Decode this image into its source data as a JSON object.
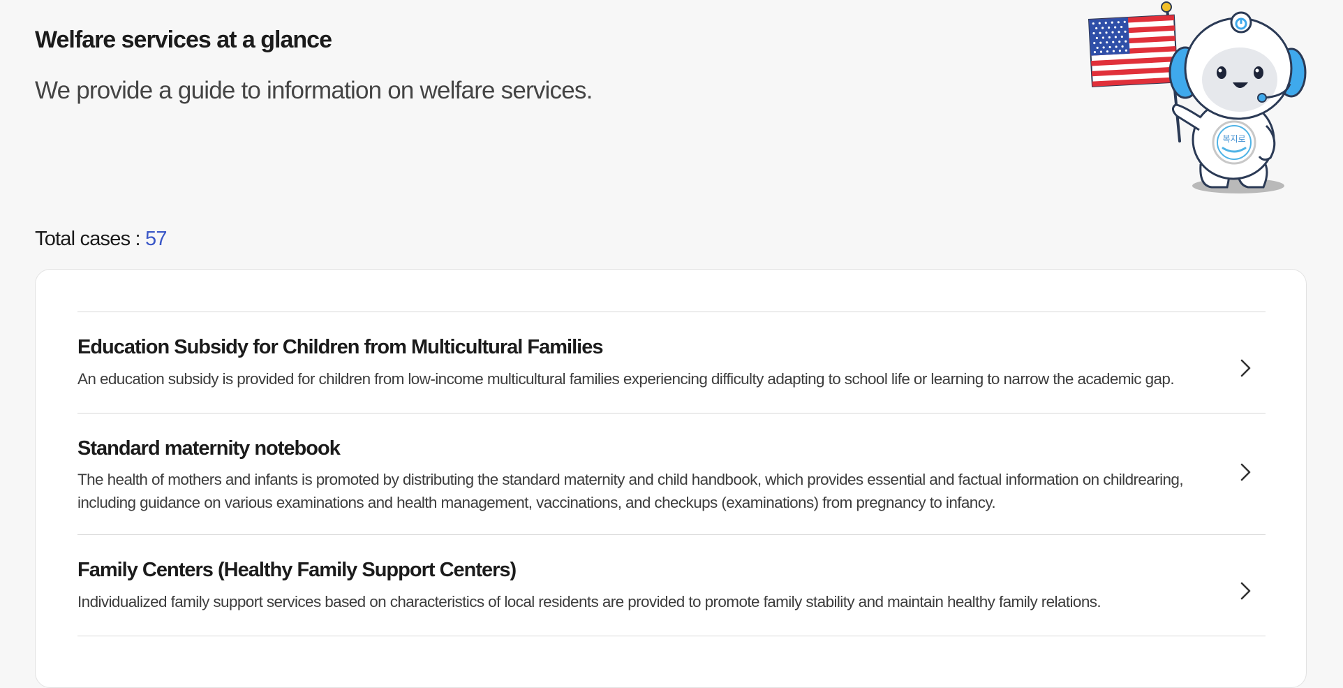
{
  "header": {
    "title": "Welfare services at a glance",
    "subtitle": "We provide a guide to information on welfare services."
  },
  "mascot": {
    "icon": "mascot-with-us-flag-icon",
    "badge_text": "복지로"
  },
  "summary": {
    "label": "Total cases : ",
    "count": "57"
  },
  "services": [
    {
      "title": "Education Subsidy for Children from Multicultural Families",
      "description": "An education subsidy is provided for children from low-income multicultural families experiencing difficulty adapting to school life or learning to narrow the academic gap.",
      "icon": "chevron-right-icon"
    },
    {
      "title": "Standard maternity notebook",
      "description": "The health of mothers and infants is promoted by distributing the standard maternity and child handbook, which provides essential and factual information on childrearing, including guidance on various examinations and health management, vaccinations, and checkups (examinations) from pregnancy to infancy.",
      "icon": "chevron-right-icon"
    },
    {
      "title": "Family Centers (Healthy Family Support Centers)",
      "description": "Individualized family support services based on characteristics of local residents are provided to promote family stability and maintain healthy family relations.",
      "icon": "chevron-right-icon"
    }
  ],
  "colors": {
    "background": "#f7f7f7",
    "count_accent": "#3a57c7",
    "card": "#ffffff",
    "divider": "#d8d8d8"
  }
}
